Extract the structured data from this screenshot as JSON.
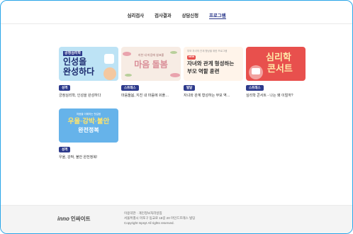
{
  "nav": {
    "items": [
      "심리검사",
      "검사결과",
      "상담신청",
      "프로그램"
    ],
    "active_index": 3
  },
  "cards": [
    {
      "badge": "성격",
      "title": "긍정심리학, 인성을 완성하다",
      "thumb": {
        "tag": "긍정심리학",
        "line1": "인성을",
        "line2": "완성하다"
      }
    },
    {
      "badge": "스트레스",
      "title": "마음돌봄, 지친 내 마음에 쉬플…",
      "thumb": {
        "small": "지친 내 마음에 쉼표를",
        "main": "마음 돌봄"
      }
    },
    {
      "badge": "발달",
      "title": "자녀와 관계 형성하는 부모 역…",
      "thumb": {
        "small": "부모 자녀의 관계 향상을 위한 프로그램",
        "pill": "NEW",
        "line1": "자녀와 관계 형성하는",
        "line2": "부모 역할 훈련"
      }
    },
    {
      "badge": "스트레스",
      "title": "심리학 콘서트 - 나는 왜 이럴까?",
      "thumb": {
        "line1": "심리학",
        "line2": "콘서트"
      }
    },
    {
      "badge": "성격",
      "title": "우울, 강박, 불안 완전정복!",
      "thumb": {
        "small": "마음을 이해하는 첫걸음",
        "line1": "우울·강박·불안",
        "line2": "완전정복"
      }
    }
  ],
  "footer": {
    "logo_mark": "inno",
    "logo_text": "인싸이트",
    "links": "이용약관 · 개인정보처리방침",
    "address": "서울특별시 마포구 동교로 18길 20 마인드프레스 빌딩",
    "copyright": "Copyright Inpsyt All rights reserved."
  },
  "colors": {
    "brand": "#2d3a8c",
    "frame": "#2aa6e8"
  }
}
